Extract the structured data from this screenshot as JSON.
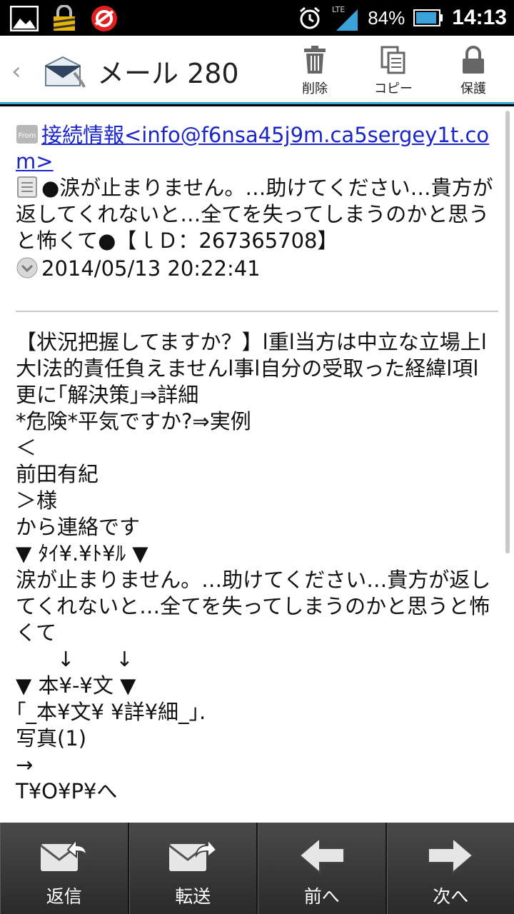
{
  "status_bar": {
    "battery_pct": "84%",
    "time": "14:13",
    "network": "LTE"
  },
  "header": {
    "title": "メール 280",
    "delete_label": "削除",
    "copy_label": "コピー",
    "protect_label": "保護"
  },
  "mail": {
    "from": "接続情報<info@f6nsa45j9m.ca5sergey1t.com>",
    "subject": "●涙が止まりません。…助けてください…貴方が返してくれないと…全てを失ってしまうのかと思うと怖くて●【ｌＤ：267365708】",
    "date": "2014/05/13 20:22:41",
    "body": [
      "【状況把握してますか？】l重l当方は中立な立場上l大l法的責任負えませんl事l自分の受取った経緯l項l更に｢解決策｣⇒詳細",
      "*危険*平気ですか?⇒実例",
      "＜",
      "前田有紀",
      "＞様",
      "から連絡です",
      "▼ ﾀｲ¥.¥ﾄ¥ﾙ ▼",
      "涙が止まりません。…助けてください…貴方が返してくれないと…全てを失ってしまうのかと思うと怖くて",
      "　　↓　　↓",
      "▼ 本¥-¥文 ▼",
      "｢_本¥文¥ ¥詳¥細_｣.",
      "写真(1)",
      "→",
      "T¥O¥P¥へ"
    ]
  },
  "bottom_bar": {
    "reply_label": "返信",
    "forward_label": "転送",
    "prev_label": "前へ",
    "next_label": "次へ"
  },
  "colors": {
    "accent": "#3aa2d8",
    "link": "#1a25c8"
  }
}
